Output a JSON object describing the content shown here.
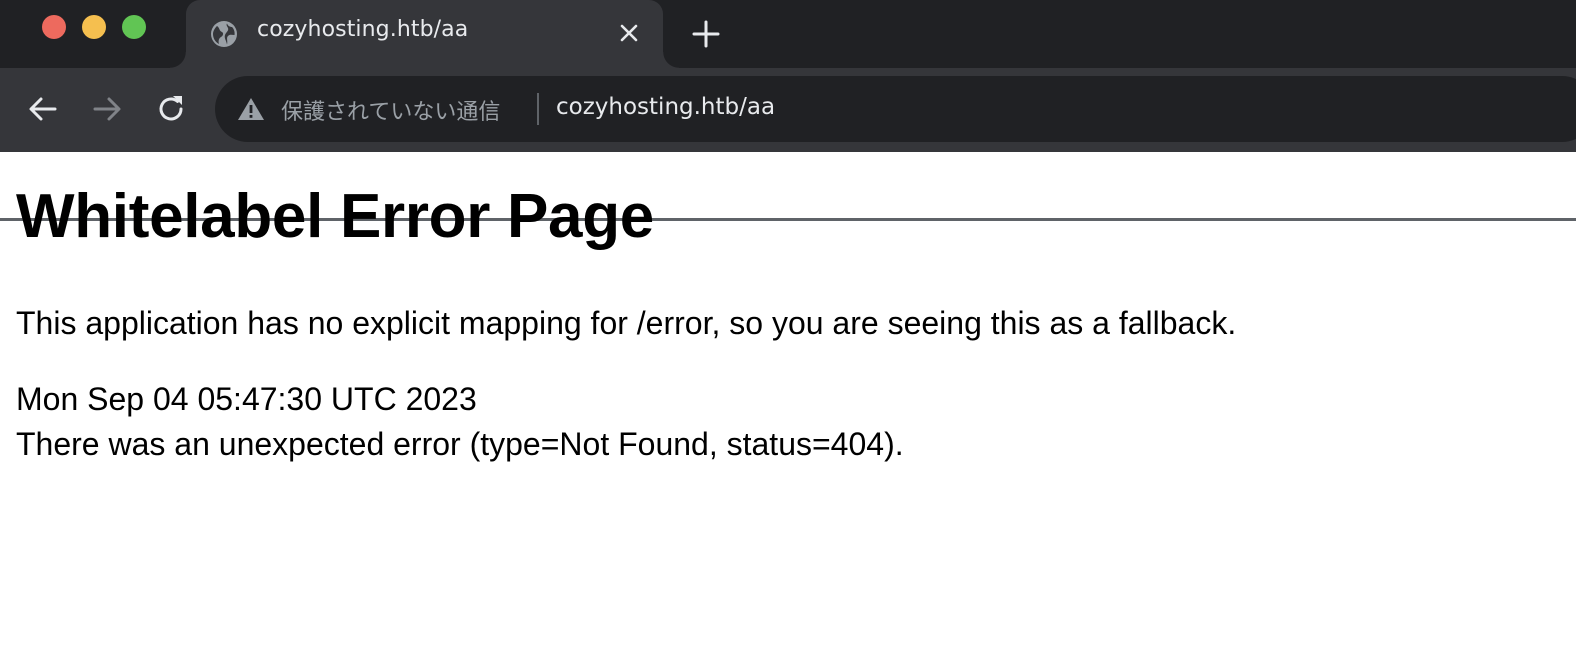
{
  "browser": {
    "tab": {
      "title": "cozyhosting.htb/aa",
      "favicon": "globe-icon"
    },
    "toolbar": {
      "security_label": "保護されていない通信",
      "url": "cozyhosting.htb/aa"
    },
    "colors": {
      "traffic_red": "#ed6a5e",
      "traffic_yellow": "#f5bf4f",
      "traffic_green": "#61c554",
      "chrome_dark": "#202124",
      "chrome_tab": "#35363a"
    }
  },
  "page": {
    "title": "Whitelabel Error Page",
    "message": "This application has no explicit mapping for /error, so you are seeing this as a fallback.",
    "timestamp": "Mon Sep 04 05:47:30 UTC 2023",
    "error": "There was an unexpected error (type=Not Found, status=404)."
  }
}
